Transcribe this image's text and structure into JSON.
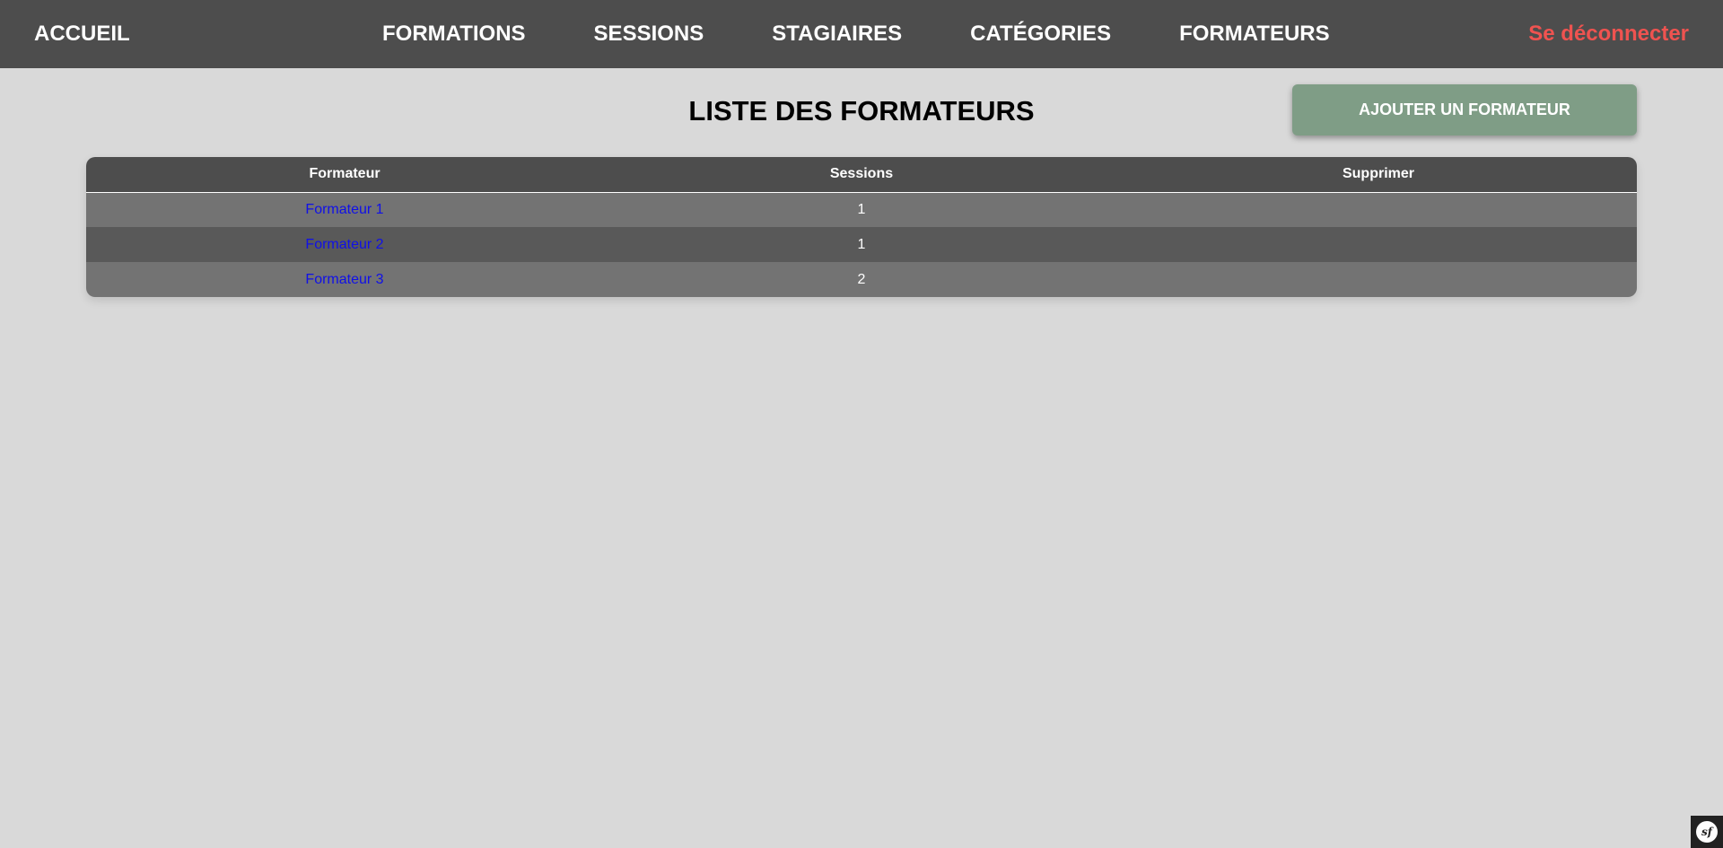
{
  "nav": {
    "home": "ACCUEIL",
    "items": [
      {
        "label": "FORMATIONS"
      },
      {
        "label": "SESSIONS"
      },
      {
        "label": "STAGIAIRES"
      },
      {
        "label": "CATÉGORIES"
      },
      {
        "label": "FORMATEURS"
      }
    ],
    "logout": "Se déconnecter",
    "logout_color": "#ef5350"
  },
  "page": {
    "title": "LISTE DES FORMATEURS",
    "add_button": "AJOUTER UN FORMATEUR"
  },
  "table": {
    "headers": [
      "Formateur",
      "Sessions",
      "Supprimer"
    ],
    "rows": [
      {
        "name": "Formateur 1",
        "sessions": "1",
        "delete": ""
      },
      {
        "name": "Formateur 2",
        "sessions": "1",
        "delete": ""
      },
      {
        "name": "Formateur 3",
        "sessions": "2",
        "delete": ""
      }
    ]
  },
  "debug_toolbar": {
    "icon": "symfony-logo-icon",
    "label": "sf"
  },
  "colors": {
    "navbar": "#4d4d4d",
    "background": "#d9d9d9",
    "add_button": "#7f9d86",
    "link": "#1010e8"
  }
}
